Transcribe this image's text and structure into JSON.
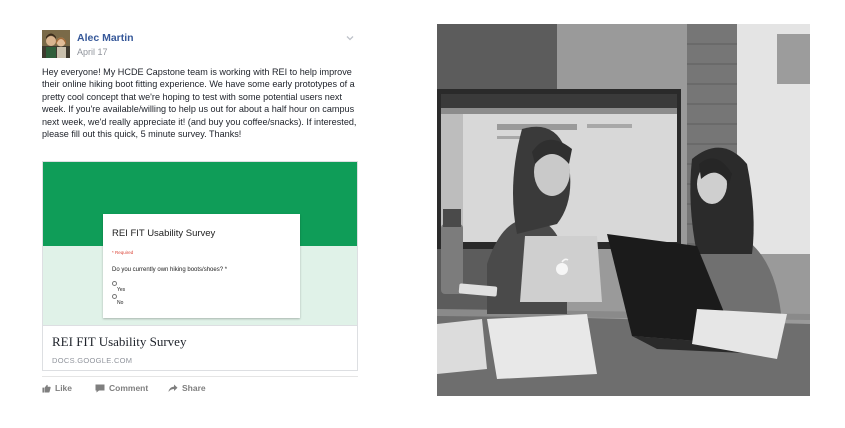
{
  "post": {
    "author": "Alec Martin",
    "date": "April 17",
    "body": "Hey everyone! My HCDE Capstone team is working with REI to help improve their online hiking boot fitting experience. We have some early prototypes of a pretty cool concept that we're hoping to test with some potential users next week. If you're available/willing to help us out for about a half hour on campus next week, we'd really appreciate it! (and buy you coffee/snacks). If interested, please fill out this quick, 5 minute survey. Thanks!",
    "link_preview": {
      "form_title": "REI FIT Usability Survey",
      "required_note": "* Required",
      "question": "Do you currently own hiking boots/shoes? *",
      "options": [
        "Yes",
        "No"
      ],
      "card_title": "REI FIT Usability Survey",
      "domain": "DOCS.GOOGLE.COM"
    },
    "actions": {
      "like": "Like",
      "comment": "Comment",
      "share": "Share"
    }
  },
  "colors": {
    "author_link": "#365899",
    "form_green": "#0f9d58",
    "form_bg": "#e0f2e8",
    "muted": "#90949c"
  },
  "icons": [
    "avatar-photo",
    "chevron-down-icon",
    "like-icon",
    "comment-icon",
    "share-icon",
    "apple-logo-icon"
  ]
}
